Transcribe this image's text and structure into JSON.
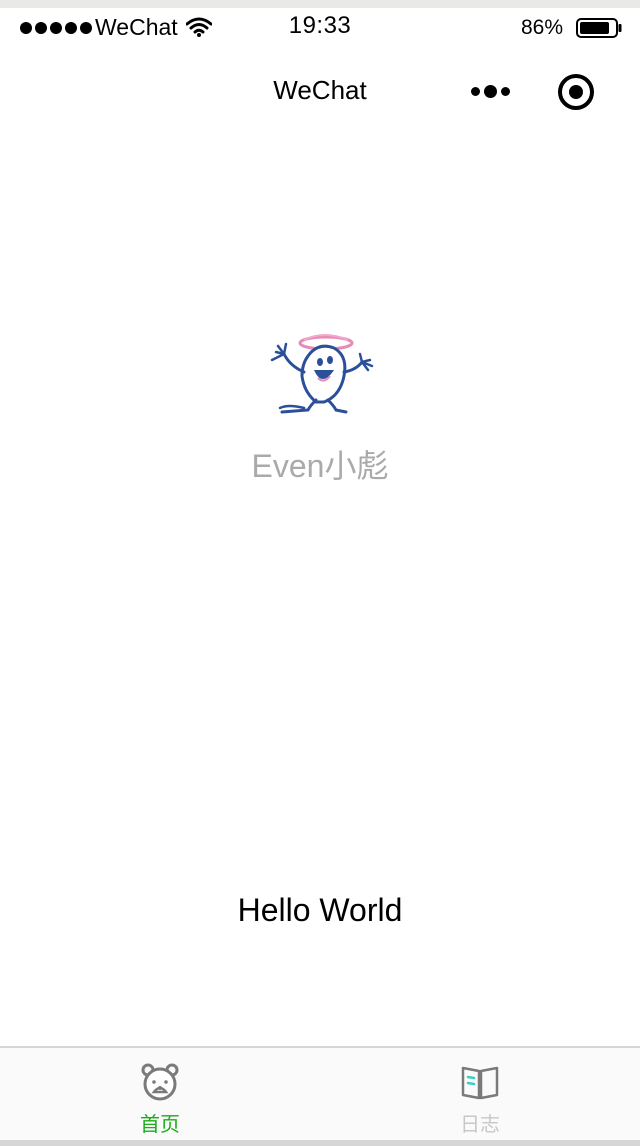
{
  "status_bar": {
    "carrier": "WeChat",
    "time": "19:33",
    "battery": "86%",
    "battery_level": 0.86,
    "signal_bars": 5,
    "signal_icon": "signal-dots-icon",
    "wifi_icon": "wifi-icon",
    "battery_icon": "battery-icon"
  },
  "nav": {
    "title": "WeChat",
    "more_icon": "more-dots-icon",
    "close_icon": "target-circle-icon"
  },
  "profile": {
    "avatar_icon": "cartoon-character-avatar",
    "nickname": "Even小彪"
  },
  "main": {
    "motto": "Hello World"
  },
  "tab_bar": {
    "items": [
      {
        "label": "首页",
        "icon": "bear-face-icon",
        "active": true
      },
      {
        "label": "日志",
        "icon": "open-book-icon",
        "active": false
      }
    ]
  },
  "colors": {
    "active_tab": "#1aad19",
    "inactive_tab": "#c8c8c8",
    "nickname": "#aaaaaa",
    "background": "#ffffff"
  }
}
